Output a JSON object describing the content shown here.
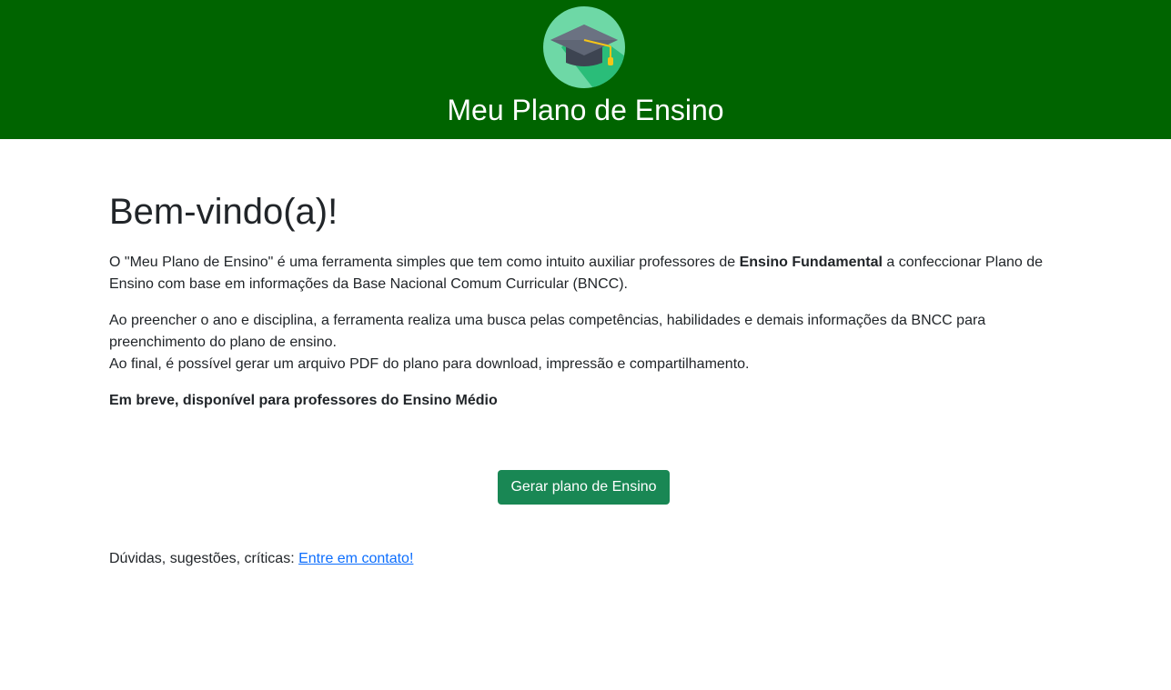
{
  "header": {
    "title": "Meu Plano de Ensino",
    "logo_icon": "graduation-cap-icon",
    "background_color": "#006400"
  },
  "main": {
    "heading": "Bem-vindo(a)!",
    "intro_part1": "O \"Meu Plano de Ensino\" é uma ferramenta simples que tem como intuito auxiliar professores de ",
    "intro_bold": "Ensino Fundamental",
    "intro_part2": " a confeccionar Plano de Ensino com base em informações da Base Nacional Comum Curricular (BNCC).",
    "description_line1": "Ao preencher o ano e disciplina, a ferramenta realiza uma busca pelas competências, habilidades e demais informações da BNCC para preenchimento do plano de ensino.",
    "description_line2": "Ao final, é possível gerar um arquivo PDF do plano para download, impressão e compartilhamento.",
    "coming_soon": "Em breve, disponível para professores do Ensino Médio",
    "cta_label": "Gerar plano de Ensino",
    "cta_color": "#198754"
  },
  "footer": {
    "contact_prefix": "Dúvidas, sugestões, críticas: ",
    "contact_link": "Entre em contato!"
  }
}
